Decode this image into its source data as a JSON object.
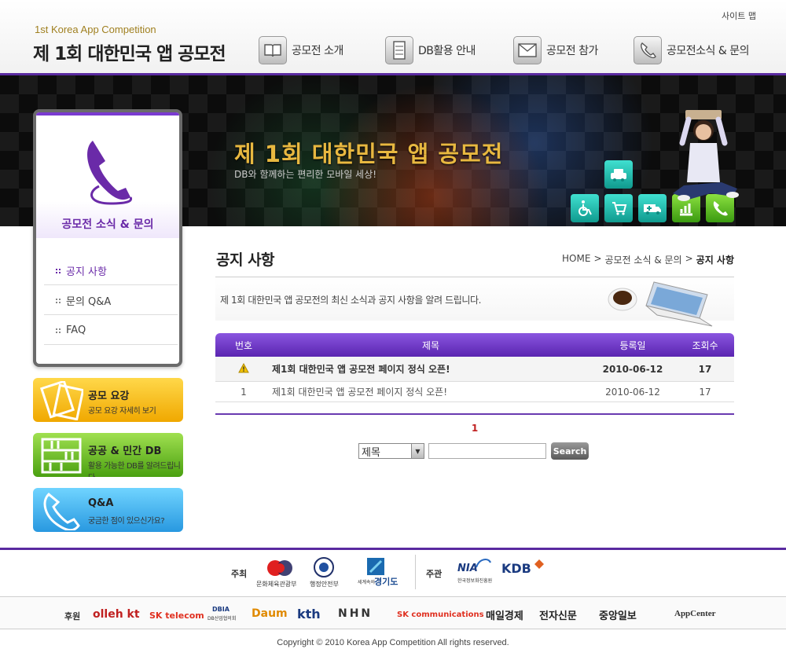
{
  "header": {
    "logo_sub": "1st Korea App Competition",
    "logo_main": "제 1회 대한민국 앱 공모전",
    "sitemap": "사이트 맵",
    "nav": [
      {
        "label": "공모전 소개",
        "icon": "book-icon"
      },
      {
        "label": "DB활용 안내",
        "icon": "cabinet-icon"
      },
      {
        "label": "공모전 참가",
        "icon": "envelope-icon"
      },
      {
        "label": "공모전소식 & 문의",
        "icon": "phone-icon"
      }
    ]
  },
  "visual": {
    "title": "제 1회 대한민국 앱 공모전",
    "subtitle": "DB와 함께하는 편리한 모바일 세상!"
  },
  "sidebar": {
    "title": "공모전 소식 & 문의",
    "items": [
      {
        "label": "공지 사항",
        "active": true
      },
      {
        "label": "문의 Q&A",
        "active": false
      },
      {
        "label": "FAQ",
        "active": false
      }
    ],
    "quick": [
      {
        "title": "공모 요강",
        "sub": "공모 요강 자세히 보기",
        "color": "#f5b800"
      },
      {
        "title": "공공 & 민간 DB",
        "sub": "활용 가능한 DB를 알려드립니다",
        "color": "#6cc020"
      },
      {
        "title": "Q&A",
        "sub": "궁금한 점이 있으신가요?",
        "color": "#30aee8"
      }
    ]
  },
  "content": {
    "page_title": "공지 사항",
    "breadcrumb": [
      "HOME",
      ">",
      "공모전 소식 & 문의",
      ">",
      "공지 사항"
    ],
    "intro": "제 1회 대한민국 앱 공모전의 최신 소식과 공지 사항을 알려 드립니다."
  },
  "board": {
    "columns": [
      "번호",
      "제목",
      "등록일",
      "조회수"
    ],
    "rows": [
      {
        "no": "",
        "title": "제1회 대한민국 앱 공모전 페이지 정식 오픈!",
        "date": "2010-06-12",
        "hits": "17",
        "notice": true
      },
      {
        "no": "1",
        "title": "제1회 대한민국 앱 공모전 페이지 정식 오픈!",
        "date": "2010-06-12",
        "hits": "17",
        "notice": false
      }
    ],
    "page": "1"
  },
  "search": {
    "field": "제목",
    "button": "Search",
    "query": ""
  },
  "footer": {
    "host_label": "주최",
    "hosts": [
      "문화체육관광부",
      "행정안전부",
      "경기도"
    ],
    "host_gg_tag": "세계속의",
    "organizer_label": "주관",
    "organizers": [
      "NIA",
      "KDB"
    ],
    "nia_sub": "한국정보화진흥원",
    "sponsor_label": "후원",
    "sponsors": [
      "olleh kt",
      "SK telecom",
      "DBIA",
      "Daum",
      "kth",
      "NHN",
      "SK communications",
      "매일경제",
      "전자신문",
      "중앙일보",
      "AppCenter"
    ],
    "dbia_sub": "DB산업협의회",
    "copyright": "Copyright © 2010  Korea App Competition All rights reserved."
  }
}
